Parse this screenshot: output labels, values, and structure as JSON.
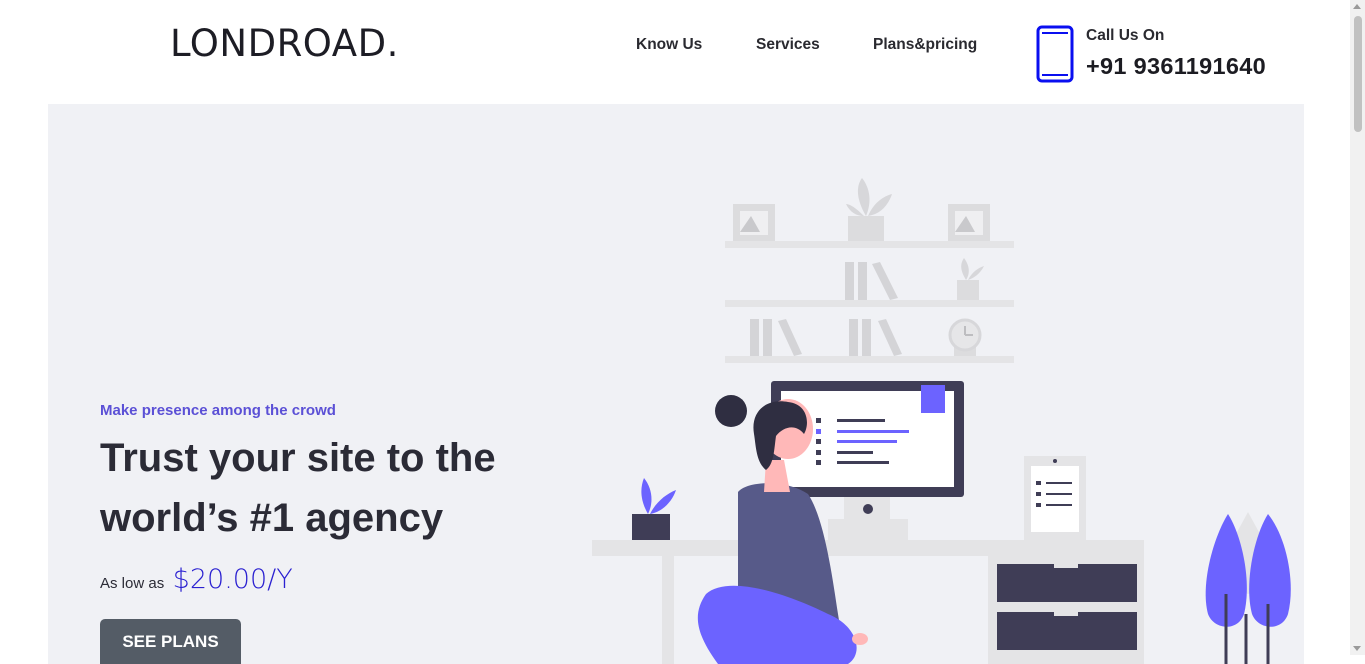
{
  "header": {
    "logo": "LONDROAD.",
    "nav": [
      {
        "label": "Know Us"
      },
      {
        "label": "Services"
      },
      {
        "label": "Plans&pricing"
      }
    ],
    "call_label": "Call Us On",
    "call_number": "+91 9361191640",
    "phone_icon": "smartphone-icon",
    "accent_color": "#0a0ff0"
  },
  "hero": {
    "tagline": "Make presence among the crowd",
    "headline": "Trust your site to the world’s #1 agency",
    "price_prefix": "As low as",
    "price_value": "$20.00/Y",
    "cta_label": "SEE PLANS",
    "illustration": "woman-at-desk-with-computer-illustration",
    "colors": {
      "background": "#f0f1f5",
      "accent_purple": "#6c63ff",
      "tagline": "#5b50d6",
      "price": "#2b21d1",
      "button": "#545c66"
    }
  }
}
